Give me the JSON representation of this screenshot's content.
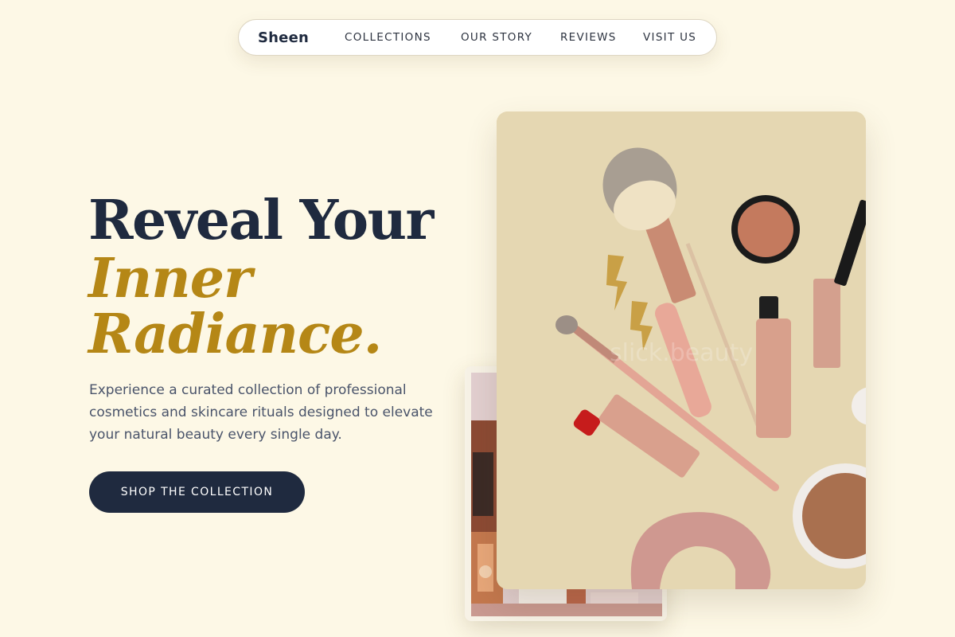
{
  "nav": {
    "brand": "Sheen",
    "links": [
      "COLLECTIONS",
      "OUR STORY",
      "REVIEWS",
      "VISIT US"
    ]
  },
  "hero": {
    "title_line1": "Reveal Your",
    "title_line2": "Inner",
    "title_line3": "Radiance.",
    "description": "Experience a curated collection of professional cosmetics and skincare rituals designed to elevate your natural beauty every single day.",
    "cta_label": "SHOP THE COLLECTION"
  },
  "images": {
    "main_watermark": "slick.beauty",
    "main_description": "Flat lay of makeup brushes, lipstick, mascara, bronzer compact and velvet scrunchie",
    "back_description": "Close-up of cosmetic bottles and products"
  },
  "colors": {
    "background": "#fdf8e6",
    "navy": "#1f2a3f",
    "gold": "#b58716",
    "body_text": "#49536a"
  }
}
